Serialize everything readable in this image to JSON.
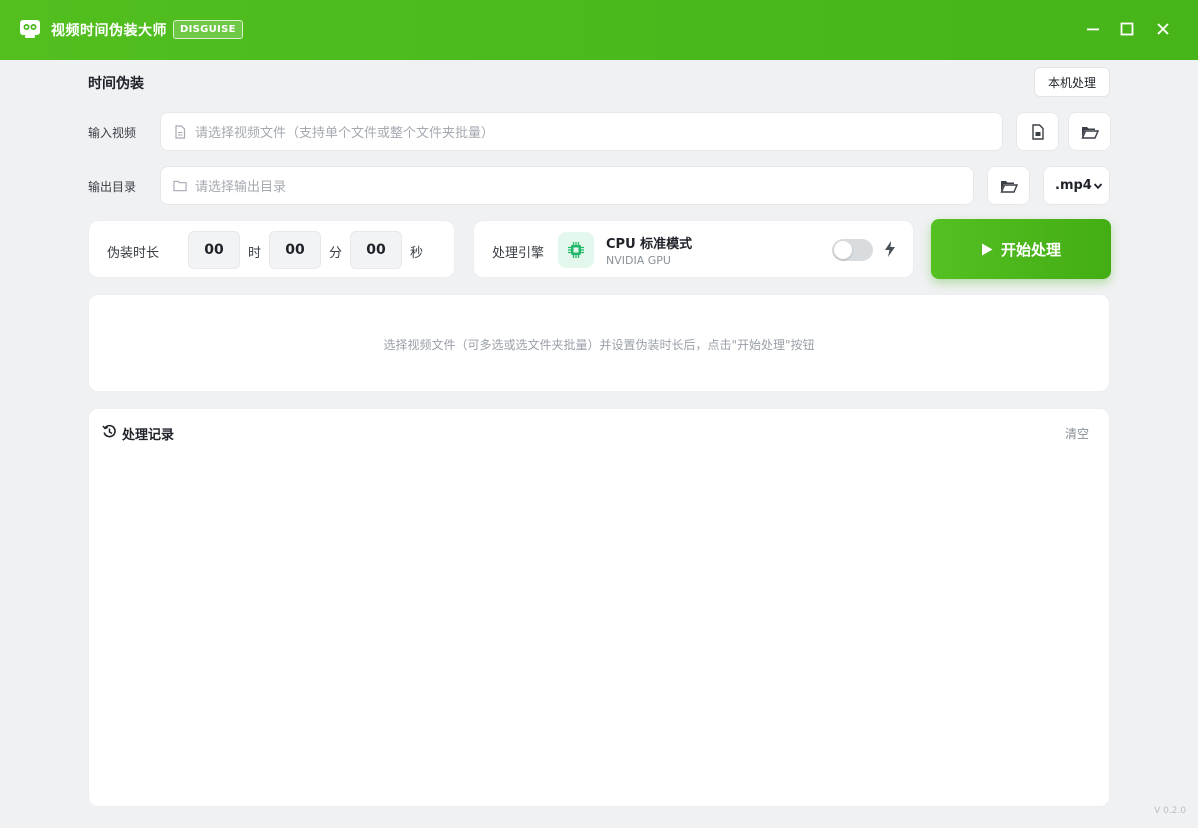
{
  "app": {
    "title": "视频时间伪装大师",
    "badge": "DISGUISE",
    "accent_color": "#4ab81c",
    "logo_icon": "film-robot-icon"
  },
  "window_controls": {
    "minimize_icon": "minimize-icon",
    "maximize_icon": "maximize-icon",
    "close_icon": "close-icon"
  },
  "header": {
    "title": "时间伪装",
    "local_button": "本机处理"
  },
  "input": {
    "label": "输入视频",
    "placeholder": "请选择视频文件（支持单个文件或整个文件夹批量）",
    "file_icon": "file-icon",
    "folder_icon": "folder-open-icon"
  },
  "output": {
    "label": "输出目录",
    "placeholder": "请选择输出目录",
    "folder_icon": "folder-open-icon",
    "format": ".mp4"
  },
  "duration": {
    "label": "伪装时长",
    "hours": "00",
    "hours_unit": "时",
    "minutes": "00",
    "minutes_unit": "分",
    "seconds": "00",
    "seconds_unit": "秒"
  },
  "engine": {
    "label": "处理引擎",
    "mode": "CPU 标准模式",
    "gpu": "NVIDIA GPU",
    "gpu_enabled": false,
    "chip_icon": "cpu-chip-icon",
    "bolt_icon": "lightning-icon"
  },
  "start_button": {
    "label": "开始处理",
    "icon": "play-icon"
  },
  "hint": "选择视频文件（可多选或选文件夹批量）并设置伪装时长后，点击\"开始处理\"按钮",
  "log": {
    "title": "处理记录",
    "clear": "清空",
    "icon": "history-icon",
    "entries": []
  },
  "version": "V 0.2.0"
}
